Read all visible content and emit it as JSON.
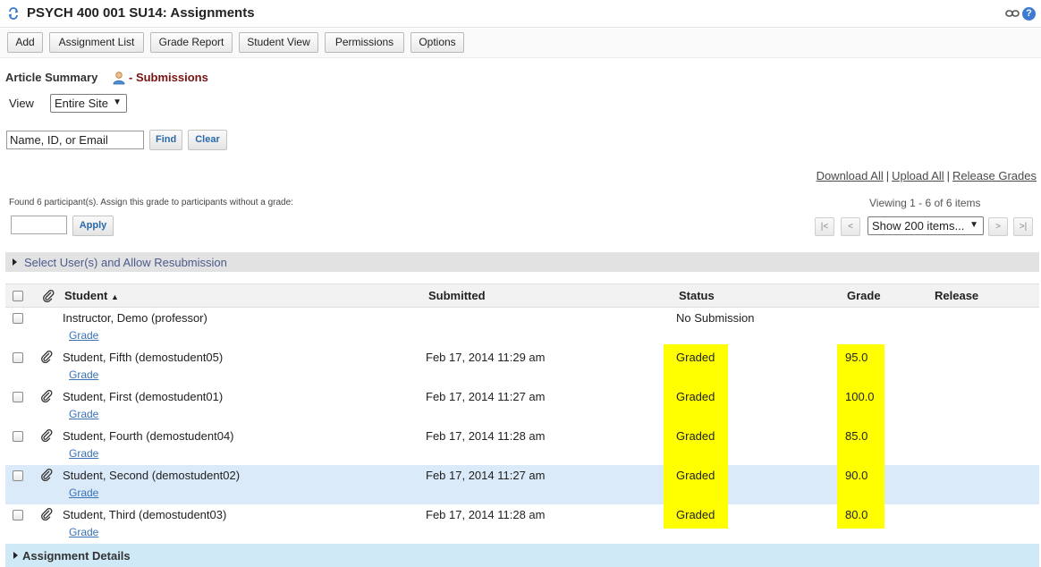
{
  "header": {
    "title": "PSYCH 400 001 SU14: Assignments",
    "help_glyph": "?"
  },
  "toolbar": {
    "buttons": [
      "Add",
      "Assignment List",
      "Grade Report",
      "Student View",
      "Permissions",
      "Options"
    ]
  },
  "summary": {
    "title": "Article Summary",
    "subtitle": "- Submissions"
  },
  "view": {
    "label": "View",
    "selected": "Entire Site"
  },
  "search": {
    "value": "Name, ID, or Email",
    "find_label": "Find",
    "clear_label": "Clear"
  },
  "links": {
    "download_all": "Download All",
    "upload_all": "Upload All",
    "release_grades": "Release Grades",
    "separator": "|"
  },
  "assign": {
    "found_text": "Found 6 participant(s). Assign this grade to participants without a grade:",
    "apply_label": "Apply"
  },
  "pager": {
    "viewing_text": "Viewing 1 - 6 of 6 items",
    "first": "|<",
    "prev": "<",
    "next": ">",
    "last": ">|",
    "page_size": "Show 200 items..."
  },
  "select_bar": {
    "label": "Select User(s) and Allow Resubmission"
  },
  "table": {
    "headers": {
      "student": "Student",
      "sort_glyph": "▲",
      "submitted": "Submitted",
      "status": "Status",
      "grade": "Grade",
      "release": "Release"
    },
    "grade_link_label": "Grade",
    "rows": [
      {
        "student": "Instructor, Demo (professor)",
        "submitted": "",
        "status": "No Submission",
        "grade": ""
      },
      {
        "student": "Student, Fifth (demostudent05)",
        "submitted": "Feb 17, 2014 11:29 am",
        "status": "Graded",
        "grade": "95.0"
      },
      {
        "student": "Student, First (demostudent01)",
        "submitted": "Feb 17, 2014 11:27 am",
        "status": "Graded",
        "grade": "100.0"
      },
      {
        "student": "Student, Fourth (demostudent04)",
        "submitted": "Feb 17, 2014 11:28 am",
        "status": "Graded",
        "grade": "85.0"
      },
      {
        "student": "Student, Second (demostudent02)",
        "submitted": "Feb 17, 2014 11:27 am",
        "status": "Graded",
        "grade": "90.0"
      },
      {
        "student": "Student, Third (demostudent03)",
        "submitted": "Feb 17, 2014 11:28 am",
        "status": "Graded",
        "grade": "80.0"
      }
    ]
  },
  "details": {
    "label": "Assignment Details"
  },
  "colors": {
    "highlight_yellow": "#ffff00",
    "link_blue": "#3b73b9",
    "row_highlight": "#dbeaf9",
    "subtitle_red": "#7a1212"
  }
}
